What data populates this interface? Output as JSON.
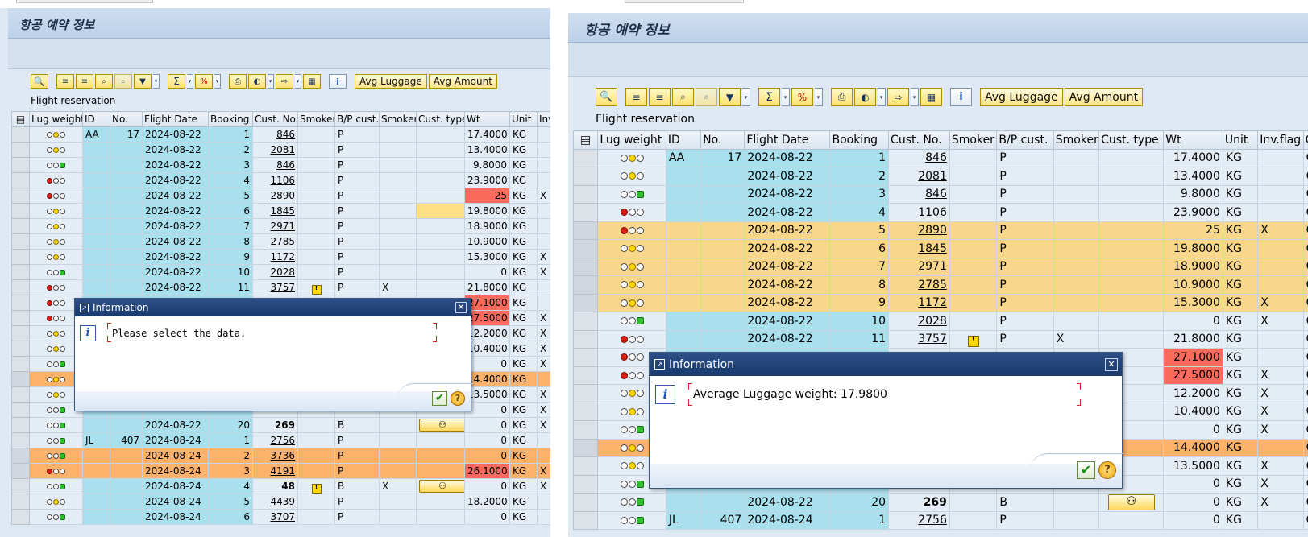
{
  "left": {
    "title": "항공 예약 정보",
    "panel_title": "Flight reservation",
    "buttons": {
      "avg_luggage": "Avg Luggage",
      "avg_amount": "Avg Amount"
    },
    "columns": [
      "Lug weight",
      "ID",
      "No.",
      "Flight Date",
      "Booking",
      "Cust. No.",
      "Smoker",
      "B/P cust.",
      "Smoker",
      "Cust. type",
      "Wt",
      "Unit",
      "Inv"
    ],
    "rows": [
      {
        "light": "yellow",
        "id": "AA",
        "no": "17",
        "date": "2024-08-22",
        "booking": "1",
        "cust": "846",
        "pcust": "P",
        "wt": "17.4000",
        "unit": "KG",
        "inv": ""
      },
      {
        "light": "yellow",
        "id": "",
        "no": "",
        "date": "2024-08-22",
        "booking": "2",
        "cust": "2081",
        "pcust": "P",
        "wt": "13.4000",
        "unit": "KG",
        "inv": ""
      },
      {
        "light": "green",
        "id": "",
        "no": "",
        "date": "2024-08-22",
        "booking": "3",
        "cust": "846",
        "pcust": "P",
        "wt": "9.8000",
        "unit": "KG",
        "inv": ""
      },
      {
        "light": "red",
        "id": "",
        "no": "",
        "date": "2024-08-22",
        "booking": "4",
        "cust": "1106",
        "pcust": "P",
        "wt": "23.9000",
        "unit": "KG",
        "inv": ""
      },
      {
        "light": "red",
        "id": "",
        "no": "",
        "date": "2024-08-22",
        "booking": "5",
        "cust": "2890",
        "pcust": "P",
        "wt": "25",
        "unit": "KG",
        "inv": "X",
        "wt_red": true
      },
      {
        "light": "yellow",
        "id": "",
        "no": "",
        "date": "2024-08-22",
        "booking": "6",
        "cust": "1845",
        "pcust": "P",
        "wt": "19.8000",
        "unit": "KG",
        "inv": "",
        "ctype_yel": true
      },
      {
        "light": "yellow",
        "id": "",
        "no": "",
        "date": "2024-08-22",
        "booking": "7",
        "cust": "2971",
        "pcust": "P",
        "wt": "18.9000",
        "unit": "KG",
        "inv": ""
      },
      {
        "light": "yellow",
        "id": "",
        "no": "",
        "date": "2024-08-22",
        "booking": "8",
        "cust": "2785",
        "pcust": "P",
        "wt": "10.9000",
        "unit": "KG",
        "inv": ""
      },
      {
        "light": "yellow",
        "id": "",
        "no": "",
        "date": "2024-08-22",
        "booking": "9",
        "cust": "1172",
        "pcust": "P",
        "wt": "15.3000",
        "unit": "KG",
        "inv": "X"
      },
      {
        "light": "green",
        "id": "",
        "no": "",
        "date": "2024-08-22",
        "booking": "10",
        "cust": "2028",
        "pcust": "P",
        "wt": "0",
        "unit": "KG",
        "inv": "X"
      },
      {
        "light": "red",
        "id": "",
        "no": "",
        "date": "2024-08-22",
        "booking": "11",
        "cust": "3757",
        "pcust": "P",
        "smoker2": "X",
        "excl": true,
        "wt": "21.8000",
        "unit": "KG",
        "inv": ""
      },
      {
        "light": "red",
        "id": "",
        "no": "",
        "date": "",
        "booking": "",
        "cust": "",
        "pcust": "",
        "wt": "27.1000",
        "unit": "KG",
        "inv": "",
        "wt_red": true
      },
      {
        "light": "red",
        "id": "",
        "no": "",
        "date": "",
        "booking": "",
        "cust": "",
        "pcust": "",
        "wt": "27.5000",
        "unit": "KG",
        "inv": "X",
        "wt_red": true
      },
      {
        "light": "yellow",
        "id": "",
        "no": "",
        "date": "",
        "booking": "",
        "cust": "",
        "pcust": "",
        "wt": "12.2000",
        "unit": "KG",
        "inv": "X"
      },
      {
        "light": "yellow",
        "id": "",
        "no": "",
        "date": "",
        "booking": "",
        "cust": "",
        "pcust": "",
        "wt": "10.4000",
        "unit": "KG",
        "inv": "X"
      },
      {
        "light": "green",
        "id": "",
        "no": "",
        "date": "",
        "booking": "",
        "cust": "",
        "pcust": "",
        "wt": "0",
        "unit": "KG",
        "inv": "X"
      },
      {
        "light": "yellow",
        "id": "",
        "no": "",
        "date": "",
        "booking": "",
        "cust": "",
        "pcust": "",
        "wt": "14.4000",
        "unit": "KG",
        "inv": "",
        "row": "orange"
      },
      {
        "light": "yellow",
        "id": "",
        "no": "",
        "date": "",
        "booking": "",
        "cust": "",
        "pcust": "",
        "wt": "13.5000",
        "unit": "KG",
        "inv": "X"
      },
      {
        "light": "green",
        "id": "",
        "no": "",
        "date": "",
        "booking": "",
        "cust": "",
        "pcust": "",
        "wt": "0",
        "unit": "KG",
        "inv": "X"
      },
      {
        "light": "green",
        "id": "",
        "no": "",
        "date": "2024-08-22",
        "booking": "20",
        "cust": "269",
        "cust_bold": true,
        "pcust": "B",
        "custbtn": true,
        "wt": "0",
        "unit": "KG",
        "inv": "X"
      },
      {
        "light": "green",
        "id": "JL",
        "no": "407",
        "date": "2024-08-24",
        "booking": "1",
        "cust": "2756",
        "pcust": "P",
        "wt": "0",
        "unit": "KG",
        "inv": ""
      },
      {
        "light": "green",
        "id": "",
        "no": "",
        "date": "2024-08-24",
        "booking": "2",
        "cust": "3736",
        "pcust": "P",
        "wt": "0",
        "unit": "KG",
        "inv": "",
        "row": "orange"
      },
      {
        "light": "red",
        "id": "",
        "no": "",
        "date": "2024-08-24",
        "booking": "3",
        "cust": "4191",
        "pcust": "P",
        "wt": "26.1000",
        "unit": "KG",
        "inv": "X",
        "row": "orange",
        "wt_red": true
      },
      {
        "light": "green",
        "id": "",
        "no": "",
        "date": "2024-08-24",
        "booking": "4",
        "cust": "48",
        "cust_bold": true,
        "pcust": "B",
        "smoker2": "X",
        "excl": true,
        "custbtn": true,
        "wt": "0",
        "unit": "KG",
        "inv": "X"
      },
      {
        "light": "yellow",
        "id": "",
        "no": "",
        "date": "2024-08-24",
        "booking": "5",
        "cust": "4439",
        "pcust": "P",
        "wt": "18.2000",
        "unit": "KG",
        "inv": ""
      },
      {
        "light": "green",
        "id": "",
        "no": "",
        "date": "2024-08-24",
        "booking": "6",
        "cust": "3707",
        "pcust": "P",
        "wt": "0",
        "unit": "KG",
        "inv": ""
      }
    ],
    "dialog": {
      "title": "Information",
      "message": "Please select the data."
    }
  },
  "right": {
    "title": "항공 예약 정보",
    "panel_title": "Flight reservation",
    "buttons": {
      "avg_luggage": "Avg Luggage",
      "avg_amount": "Avg Amount"
    },
    "columns": [
      "Lug weight",
      "ID",
      "No.",
      "Flight Date",
      "Booking",
      "Cust. No.",
      "Smoker",
      "B/P cust.",
      "Smoker",
      "Cust. type",
      "Wt",
      "Unit",
      "Inv.flag",
      "Clas"
    ],
    "rows": [
      {
        "light": "yellow",
        "id": "AA",
        "no": "17",
        "date": "2024-08-22",
        "booking": "1",
        "cust": "846",
        "pcust": "P",
        "wt": "17.4000",
        "unit": "KG",
        "inv": "",
        "cls": "C"
      },
      {
        "light": "yellow",
        "id": "",
        "no": "",
        "date": "2024-08-22",
        "booking": "2",
        "cust": "2081",
        "pcust": "P",
        "wt": "13.4000",
        "unit": "KG",
        "inv": "",
        "cls": "C"
      },
      {
        "light": "green",
        "id": "",
        "no": "",
        "date": "2024-08-22",
        "booking": "3",
        "cust": "846",
        "pcust": "P",
        "wt": "9.8000",
        "unit": "KG",
        "inv": "",
        "cls": "C"
      },
      {
        "light": "red",
        "id": "",
        "no": "",
        "date": "2024-08-22",
        "booking": "4",
        "cust": "1106",
        "pcust": "P",
        "wt": "23.9000",
        "unit": "KG",
        "inv": "",
        "cls": "C"
      },
      {
        "light": "red",
        "id": "",
        "no": "",
        "date": "2024-08-22",
        "booking": "5",
        "cust": "2890",
        "pcust": "P",
        "wt": "25",
        "unit": "KG",
        "inv": "X",
        "cls": "C",
        "row": "sel"
      },
      {
        "light": "yellow",
        "id": "",
        "no": "",
        "date": "2024-08-22",
        "booking": "6",
        "cust": "1845",
        "pcust": "P",
        "wt": "19.8000",
        "unit": "KG",
        "inv": "",
        "cls": "C",
        "row": "sel"
      },
      {
        "light": "yellow",
        "id": "",
        "no": "",
        "date": "2024-08-22",
        "booking": "7",
        "cust": "2971",
        "pcust": "P",
        "wt": "18.9000",
        "unit": "KG",
        "inv": "",
        "cls": "C",
        "row": "sel"
      },
      {
        "light": "yellow",
        "id": "",
        "no": "",
        "date": "2024-08-22",
        "booking": "8",
        "cust": "2785",
        "pcust": "P",
        "wt": "10.9000",
        "unit": "KG",
        "inv": "",
        "cls": "C",
        "row": "sel"
      },
      {
        "light": "yellow",
        "id": "",
        "no": "",
        "date": "2024-08-22",
        "booking": "9",
        "cust": "1172",
        "pcust": "P",
        "wt": "15.3000",
        "unit": "KG",
        "inv": "X",
        "cls": "C",
        "row": "sel"
      },
      {
        "light": "green",
        "id": "",
        "no": "",
        "date": "2024-08-22",
        "booking": "10",
        "cust": "2028",
        "pcust": "P",
        "wt": "0",
        "unit": "KG",
        "inv": "X",
        "cls": "C"
      },
      {
        "light": "red",
        "id": "",
        "no": "",
        "date": "2024-08-22",
        "booking": "11",
        "cust": "3757",
        "pcust": "P",
        "smoker2": "X",
        "excl": true,
        "wt": "21.8000",
        "unit": "KG",
        "inv": "",
        "cls": "C"
      },
      {
        "light": "red",
        "id": "",
        "no": "",
        "date": "",
        "booking": "",
        "cust": "",
        "pcust": "",
        "wt": "27.1000",
        "unit": "KG",
        "inv": "",
        "cls": "C",
        "wt_red": true
      },
      {
        "light": "red",
        "id": "",
        "no": "",
        "date": "",
        "booking": "",
        "cust": "",
        "pcust": "",
        "wt": "27.5000",
        "unit": "KG",
        "inv": "X",
        "cls": "C",
        "wt_red": true
      },
      {
        "light": "yellow",
        "id": "",
        "no": "",
        "date": "",
        "booking": "",
        "cust": "",
        "pcust": "",
        "wt": "12.2000",
        "unit": "KG",
        "inv": "X",
        "cls": "C"
      },
      {
        "light": "yellow",
        "id": "",
        "no": "",
        "date": "",
        "booking": "",
        "cust": "",
        "pcust": "",
        "wt": "10.4000",
        "unit": "KG",
        "inv": "X",
        "cls": "C"
      },
      {
        "light": "green",
        "id": "",
        "no": "",
        "date": "",
        "booking": "",
        "cust": "",
        "pcust": "",
        "wt": "0",
        "unit": "KG",
        "inv": "X",
        "cls": "C"
      },
      {
        "light": "yellow",
        "id": "",
        "no": "",
        "date": "",
        "booking": "",
        "cust": "",
        "pcust": "",
        "wt": "14.4000",
        "unit": "KG",
        "inv": "",
        "cls": "C",
        "row": "orange"
      },
      {
        "light": "yellow",
        "id": "",
        "no": "",
        "date": "",
        "booking": "",
        "cust": "",
        "pcust": "",
        "wt": "13.5000",
        "unit": "KG",
        "inv": "X",
        "cls": "C"
      },
      {
        "light": "green",
        "id": "",
        "no": "",
        "date": "",
        "booking": "",
        "cust": "",
        "pcust": "",
        "wt": "0",
        "unit": "KG",
        "inv": "X",
        "cls": "C"
      },
      {
        "light": "green",
        "id": "",
        "no": "",
        "date": "2024-08-22",
        "booking": "20",
        "cust": "269",
        "cust_bold": true,
        "pcust": "B",
        "custbtn": true,
        "wt": "0",
        "unit": "KG",
        "inv": "X",
        "cls": "C"
      },
      {
        "light": "green",
        "id": "JL",
        "no": "407",
        "date": "2024-08-24",
        "booking": "1",
        "cust": "2756",
        "pcust": "P",
        "wt": "0",
        "unit": "KG",
        "inv": "",
        "cls": "C"
      }
    ],
    "dialog": {
      "title": "Information",
      "message": "Average Luggage weight: 17.9800"
    }
  }
}
